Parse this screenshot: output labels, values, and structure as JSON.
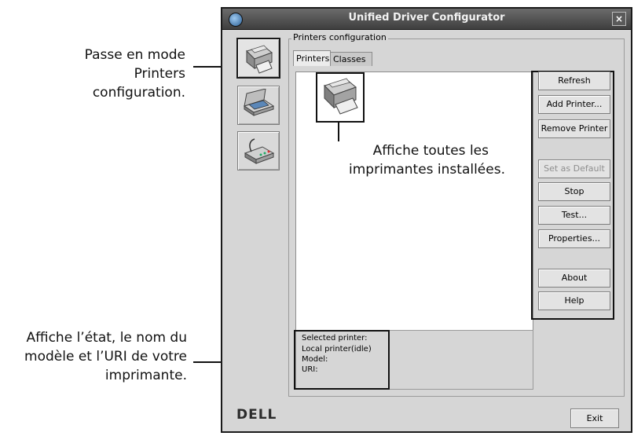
{
  "window": {
    "title": "Unified Driver Configurator"
  },
  "sidebar": {
    "items": [
      {
        "name": "printers",
        "icon": "printer-icon",
        "active": true
      },
      {
        "name": "scanners",
        "icon": "scanner-icon",
        "active": false
      },
      {
        "name": "ports",
        "icon": "port-icon",
        "active": false
      }
    ]
  },
  "main": {
    "group_title": "Printers configuration",
    "tabs": [
      {
        "label": "Printers",
        "active": true
      },
      {
        "label": "Classes",
        "active": false
      }
    ]
  },
  "buttons": {
    "refresh": "Refresh",
    "add_printer": "Add Printer...",
    "remove_printer": "Remove Printer",
    "set_as_default": "Set as Default",
    "stop": "Stop",
    "test": "Test...",
    "properties": "Properties...",
    "about": "About",
    "help": "Help"
  },
  "selected_printer": {
    "label": "Selected printer:",
    "status": "Local printer(idle)",
    "model_label": "Model:",
    "uri_label": "URI:"
  },
  "footer": {
    "logo_text": "DELL",
    "exit": "Exit"
  },
  "callouts": {
    "printers_mode_line1": "Passe en mode Printers",
    "printers_mode_line2": "configuration.",
    "installed_line1": "Affiche toutes les",
    "installed_line2": "imprimantes installées.",
    "status_line1": "Affiche l’état, le nom du",
    "status_line2": "modèle et l’URI de votre",
    "status_line3": "imprimante."
  },
  "colors": {
    "window_bg": "#d6d6d6",
    "titlebar": "#4a4a4a",
    "list_bg": "#ffffff",
    "highlight_border": "#111111",
    "disabled_text": "#8e8e8e"
  }
}
